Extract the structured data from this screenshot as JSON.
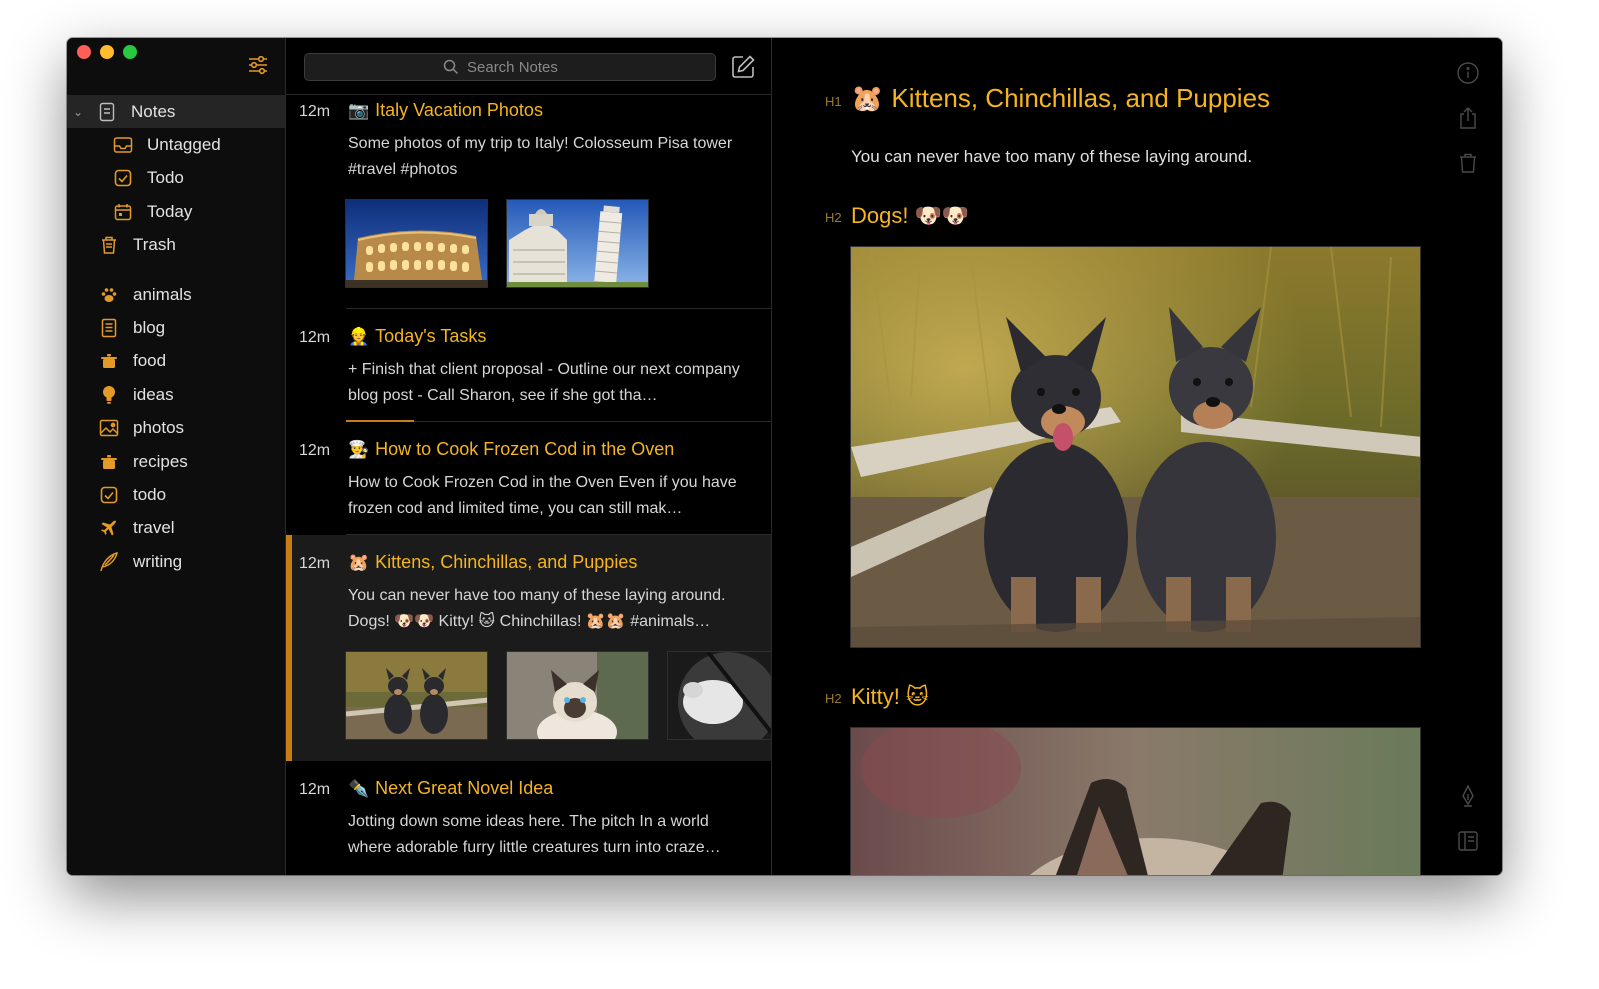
{
  "window": {
    "controls": [
      "close",
      "minimize",
      "zoom"
    ]
  },
  "sidebar": {
    "filter_icon": "sliders-icon",
    "top_items": [
      {
        "label": "Notes",
        "icon": "note-icon",
        "active": true,
        "expandable": true
      },
      {
        "label": "Untagged",
        "icon": "inbox-icon"
      },
      {
        "label": "Todo",
        "icon": "checkbox-icon"
      },
      {
        "label": "Today",
        "icon": "calendar-icon"
      },
      {
        "label": "Trash",
        "icon": "trash-icon"
      }
    ],
    "tags": [
      {
        "label": "animals",
        "icon": "paw-icon"
      },
      {
        "label": "blog",
        "icon": "document-icon"
      },
      {
        "label": "food",
        "icon": "pot-icon"
      },
      {
        "label": "ideas",
        "icon": "bulb-icon"
      },
      {
        "label": "photos",
        "icon": "picture-icon"
      },
      {
        "label": "recipes",
        "icon": "pot-icon"
      },
      {
        "label": "todo",
        "icon": "checkbox-icon"
      },
      {
        "label": "travel",
        "icon": "plane-icon"
      },
      {
        "label": "writing",
        "icon": "feather-icon"
      }
    ]
  },
  "search": {
    "placeholder": "Search Notes"
  },
  "notes": [
    {
      "time": "12m",
      "emoji": "📷",
      "title": "Italy Vacation Photos",
      "body": "Some photos of my trip to Italy! Colosseum Pisa tower #travel #photos",
      "thumbnails": [
        "colosseum",
        "pisa-tower"
      ]
    },
    {
      "time": "12m",
      "emoji": "👷",
      "title": "Today's Tasks",
      "body": "+ Finish that client proposal - Outline our next company blog post - Call Sharon, see if she got tha…",
      "progress": 0.17
    },
    {
      "time": "12m",
      "emoji": "👨‍🍳",
      "title": "How to Cook Frozen Cod in the Oven",
      "body": "How to Cook Frozen Cod in the Oven Even if you have frozen cod and limited time, you can still mak…"
    },
    {
      "time": "12m",
      "emoji": "🐹",
      "title": "Kittens, Chinchillas, and Puppies",
      "body": "You can never have too many of these laying around. Dogs! 🐶🐶 Kitty! 🐱 Chinchillas! 🐹🐹 #animals…",
      "thumbnails": [
        "dogs",
        "kitten",
        "chinchilla"
      ],
      "selected": true
    },
    {
      "time": "12m",
      "emoji": "✒️",
      "title": "Next Great Novel Idea",
      "body": "Jotting down some ideas here. The pitch In a world where adorable furry little creatures turn into craze…"
    }
  ],
  "editor": {
    "h1_marker": "H1",
    "h1_emoji": "🐹",
    "title": "Kittens, Chinchillas, and Puppies",
    "paragraph": "You can never have too many of these laying around.",
    "h2_marker": "H2",
    "section1": "Dogs!",
    "section1_emoji": "🐶🐶",
    "section2": "Kitty!",
    "section2_emoji": "🐱",
    "tools": [
      "info-icon",
      "share-icon",
      "trash-icon",
      "pen-icon",
      "panel-icon"
    ]
  },
  "colors": {
    "accent": "#f6b51e",
    "selection_bar": "#c77d14",
    "background": "#000000"
  }
}
